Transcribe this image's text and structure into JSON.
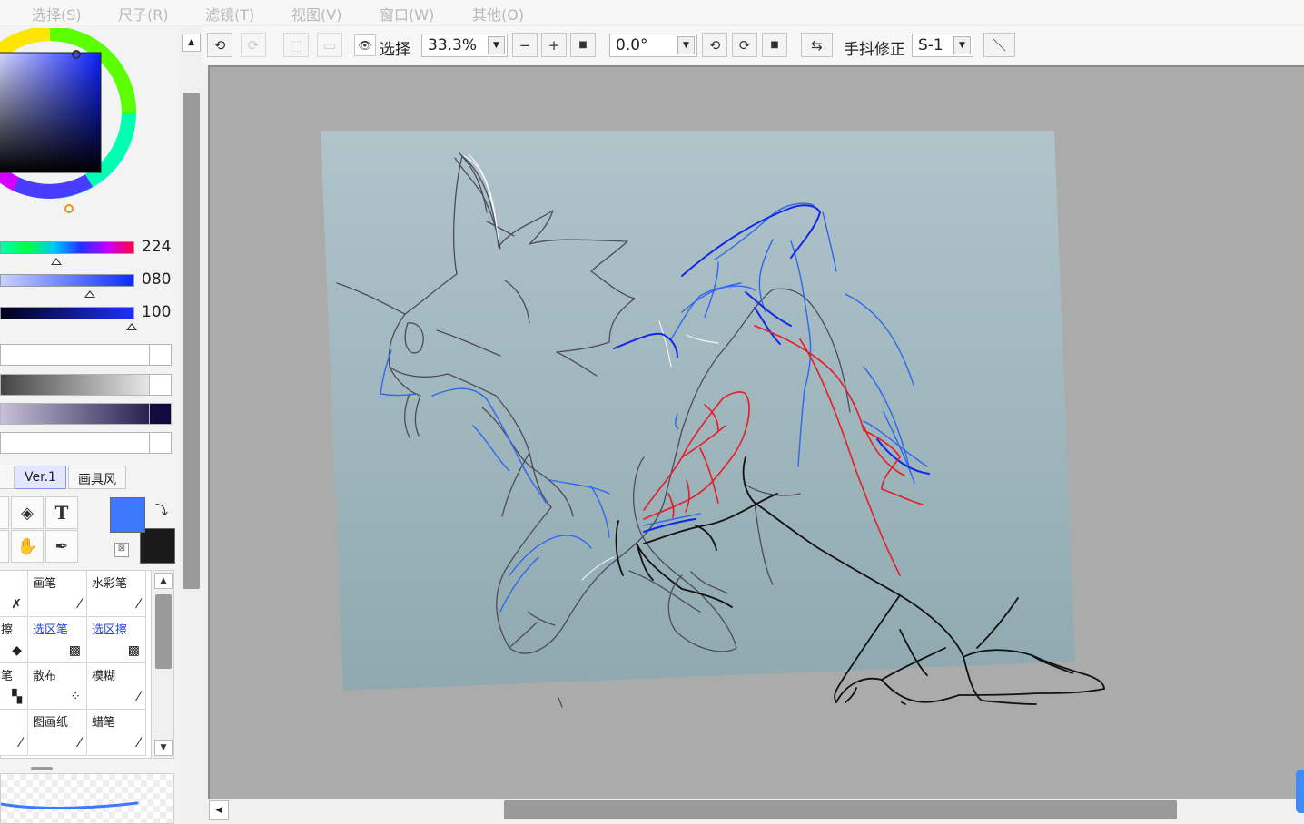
{
  "menu": [
    "选择(S)",
    "尺子(R)",
    "滤镜(T)",
    "视图(V)",
    "窗口(W)",
    "其他(O)"
  ],
  "color_panel": {
    "sliders": [
      {
        "label": "hue",
        "value": "224",
        "level": 0.42
      },
      {
        "label": "saturation",
        "value": "080",
        "level": 0.67
      },
      {
        "label": "value",
        "value": "100",
        "level": 0.98
      }
    ],
    "foreground_color": "#3c79ff",
    "background_color": "#1a1a1a",
    "tabs": [
      "Ver.1",
      "画具风"
    ]
  },
  "tools": {
    "icons": [
      "bucket-icon",
      "text-icon",
      "hand-icon",
      "eyedropper-icon",
      "swap-icon",
      "transparent-icon"
    ],
    "text_tool_glyph": "T"
  },
  "brushes": [
    {
      "name": "",
      "icon": "pen-icon"
    },
    {
      "name": "画笔",
      "icon": "brush-icon"
    },
    {
      "name": "水彩笔",
      "icon": "watercolor-icon"
    },
    {
      "name": "擦",
      "icon": "eraser-icon"
    },
    {
      "name": "选区笔",
      "icon": "selection-pen-icon",
      "blue": true
    },
    {
      "name": "选区擦",
      "icon": "selection-eraser-icon",
      "blue": true
    },
    {
      "name": "笔",
      "icon": "pencil-icon"
    },
    {
      "name": "散布",
      "icon": "scatter-icon"
    },
    {
      "name": "模糊",
      "icon": "blur-icon"
    },
    {
      "name": "",
      "icon": "marker-icon"
    },
    {
      "name": "图画纸",
      "icon": "paper-icon"
    },
    {
      "name": "蜡笔",
      "icon": "crayon-icon"
    }
  ],
  "toolbar": {
    "select_label": "选择",
    "zoom": "33.3%",
    "rotation": "0.0°",
    "stabilizer_label": "手抖修正",
    "stabilizer_value": "S-1"
  },
  "canvas": {
    "background": "#ababab",
    "paper_color_top": "#b0c4ca",
    "paper_color_bottom": "#8fa9b0"
  }
}
